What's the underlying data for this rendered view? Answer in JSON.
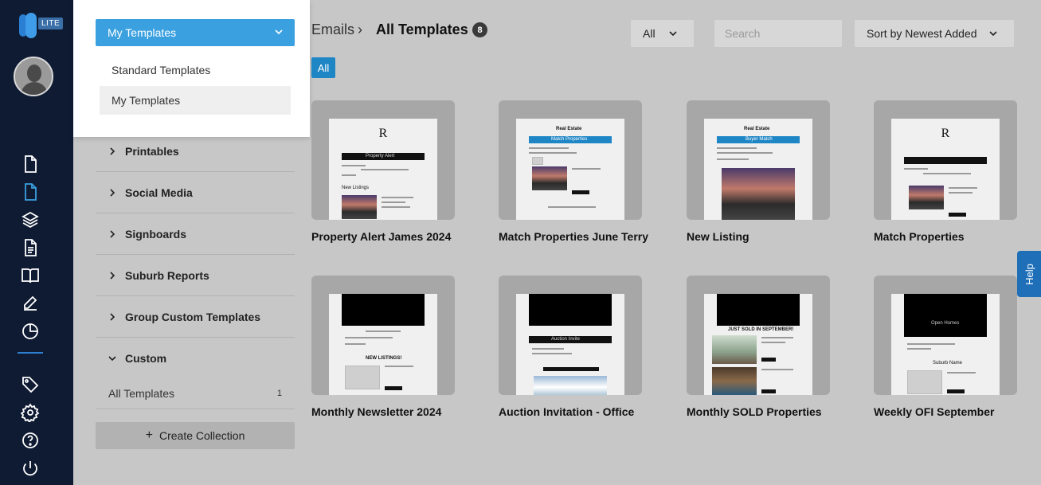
{
  "brand": {
    "badge": "LITE",
    "accent": "#3aa0e0",
    "rail_bg": "#0f1b33"
  },
  "rail": {
    "icons": [
      "document-icon",
      "document-active-icon",
      "layers-icon",
      "file-text-icon",
      "book-icon",
      "edit-icon",
      "pie-chart-icon",
      "tag-icon",
      "gear-icon",
      "help-circle-icon",
      "power-icon"
    ]
  },
  "dropdown": {
    "selected": "My Templates",
    "options": [
      "Standard Templates",
      "My Templates"
    ]
  },
  "collections": [
    {
      "label": "Printables"
    },
    {
      "label": "Social Media"
    },
    {
      "label": "Signboards"
    },
    {
      "label": "Suburb Reports"
    },
    {
      "label": "Group Custom Templates"
    },
    {
      "label": "Custom"
    }
  ],
  "custom_sub": {
    "label": "All Templates",
    "count": "1"
  },
  "create_collection": "Create Collection",
  "header": {
    "breadcrumb_root": "Emails",
    "breadcrumb_sep": "›",
    "breadcrumb_current": "All Templates",
    "count": "8",
    "filter_value": "All",
    "search_placeholder": "Search",
    "sort_value": "Sort by Newest Added",
    "tag_all": "All"
  },
  "templates": [
    {
      "title": "Property Alert James 2024"
    },
    {
      "title": "Match Properties June Terry"
    },
    {
      "title": "New Listing"
    },
    {
      "title": "Match Properties"
    },
    {
      "title": "Monthly Newsletter 2024"
    },
    {
      "title": "Auction Invitation - Office"
    },
    {
      "title": "Monthly SOLD Properties"
    },
    {
      "title": "Weekly OFI September"
    }
  ],
  "thumb_text": {
    "property_alert_band": "Property Alert",
    "new_listings": "New Listings",
    "real_estate": "Real Estate",
    "match_properties_band": "Match Properties",
    "buyer_match_band": "Buyer Match",
    "new_listings_caps": "NEW LISTINGS!",
    "auction_invite_band": "Auction Invite",
    "just_sold": "JUST SOLD IN SEPTEMBER!",
    "open_homes_band": "Open Homes",
    "suburb": "Suburb Name"
  },
  "help": "Help"
}
